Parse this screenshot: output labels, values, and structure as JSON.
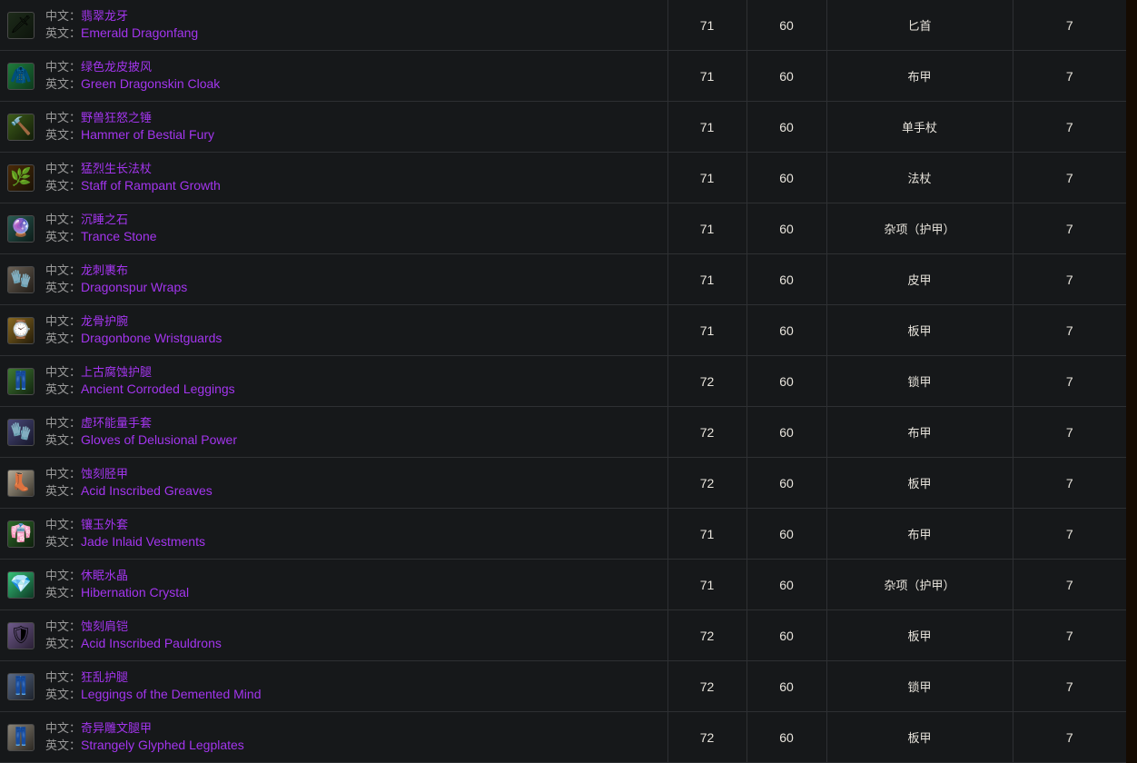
{
  "table": {
    "labels": {
      "cn_label": "中文：",
      "en_label": "英文："
    },
    "colors": {
      "item_name": "#a335ee",
      "label_text": "#9a9a9a",
      "cell_text": "#e8e4dc",
      "row_background": "#16181a",
      "gridline": "#2e3033",
      "page_background": "#150b02"
    },
    "rows": [
      {
        "icon": "dagger-green-icon",
        "icon_glyph": "🗡",
        "icon_bg": "linear-gradient(135deg,#1d2b1a 0%,#0d140c 100%)",
        "name_cn": "翡翠龙牙",
        "name_en": "Emerald Dragonfang",
        "item_level": "71",
        "required_level": "60",
        "type": "匕首",
        "source": "7"
      },
      {
        "icon": "cloak-green-icon",
        "icon_glyph": "🧥",
        "icon_bg": "linear-gradient(135deg,#1f7a3c 0%,#0c3a1c 100%)",
        "name_cn": "绿色龙皮披风",
        "name_en": "Green Dragonskin Cloak",
        "item_level": "71",
        "required_level": "60",
        "type": "布甲",
        "source": "7"
      },
      {
        "icon": "mace-green-icon",
        "icon_glyph": "🔨",
        "icon_bg": "linear-gradient(135deg,#3d5c1a 0%,#121c08 100%)",
        "name_cn": "野兽狂怒之锤",
        "name_en": "Hammer of Bestial Fury",
        "item_level": "71",
        "required_level": "60",
        "type": "单手杖",
        "source": "7"
      },
      {
        "icon": "staff-green-icon",
        "icon_glyph": "🌿",
        "icon_bg": "linear-gradient(135deg,#4a2a08 0%,#1a1205 100%)",
        "name_cn": "猛烈生长法杖",
        "name_en": "Staff of Rampant Growth",
        "item_level": "71",
        "required_level": "60",
        "type": "法杖",
        "source": "7"
      },
      {
        "icon": "orb-stone-icon",
        "icon_glyph": "🔮",
        "icon_bg": "linear-gradient(135deg,#2a5b52 0%,#0c1c19 100%)",
        "name_cn": "沉睡之石",
        "name_en": "Trance Stone",
        "item_level": "71",
        "required_level": "60",
        "type": "杂项（护甲）",
        "source": "7"
      },
      {
        "icon": "bracers-leather-icon",
        "icon_glyph": "🧤",
        "icon_bg": "linear-gradient(135deg,#6b6156 0%,#221d17 100%)",
        "name_cn": "龙刺裹布",
        "name_en": "Dragonspur Wraps",
        "item_level": "71",
        "required_level": "60",
        "type": "皮甲",
        "source": "7"
      },
      {
        "icon": "bracers-plate-icon",
        "icon_glyph": "⌚",
        "icon_bg": "linear-gradient(135deg,#8a6a22 0%,#251c08 100%)",
        "name_cn": "龙骨护腕",
        "name_en": "Dragonbone Wristguards",
        "item_level": "71",
        "required_level": "60",
        "type": "板甲",
        "source": "7"
      },
      {
        "icon": "leggings-mail-icon",
        "icon_glyph": "👖",
        "icon_bg": "linear-gradient(135deg,#3f7a33 0%,#12240f 100%)",
        "name_cn": "上古腐蚀护腿",
        "name_en": "Ancient Corroded Leggings",
        "item_level": "72",
        "required_level": "60",
        "type": "锁甲",
        "source": "7"
      },
      {
        "icon": "gloves-cloth-icon",
        "icon_glyph": "🧤",
        "icon_bg": "linear-gradient(135deg,#4a4a7a 0%,#16162a 100%)",
        "name_cn": "虚环能量手套",
        "name_en": "Gloves of Delusional Power",
        "item_level": "72",
        "required_level": "60",
        "type": "布甲",
        "source": "7"
      },
      {
        "icon": "boots-plate-icon",
        "icon_glyph": "👢",
        "icon_bg": "linear-gradient(135deg,#b5ab97 0%,#3a352c 100%)",
        "name_cn": "蚀刻胫甲",
        "name_en": "Acid Inscribed Greaves",
        "item_level": "72",
        "required_level": "60",
        "type": "板甲",
        "source": "7"
      },
      {
        "icon": "robe-cloth-icon",
        "icon_glyph": "👘",
        "icon_bg": "linear-gradient(135deg,#2e6b2a 0%,#0e1f0c 100%)",
        "name_cn": "镶玉外套",
        "name_en": "Jade Inlaid Vestments",
        "item_level": "71",
        "required_level": "60",
        "type": "布甲",
        "source": "7"
      },
      {
        "icon": "crystal-green-icon",
        "icon_glyph": "💎",
        "icon_bg": "linear-gradient(135deg,#35c27a 0%,#0d3a24 100%)",
        "name_cn": "休眠水晶",
        "name_en": "Hibernation Crystal",
        "item_level": "71",
        "required_level": "60",
        "type": "杂项（护甲）",
        "source": "7"
      },
      {
        "icon": "pauldrons-plate-icon",
        "icon_glyph": "🛡",
        "icon_bg": "linear-gradient(135deg,#6e5a8a 0%,#2a2035 100%)",
        "name_cn": "蚀刻肩铠",
        "name_en": "Acid Inscribed Pauldrons",
        "item_level": "72",
        "required_level": "60",
        "type": "板甲",
        "source": "7"
      },
      {
        "icon": "leggings-mail-blue-icon",
        "icon_glyph": "👖",
        "icon_bg": "linear-gradient(135deg,#5a6a86 0%,#1c222c 100%)",
        "name_cn": "狂乱护腿",
        "name_en": "Leggings of the Demented Mind",
        "item_level": "72",
        "required_level": "60",
        "type": "锁甲",
        "source": "7"
      },
      {
        "icon": "legplates-plate-icon",
        "icon_glyph": "👖",
        "icon_bg": "linear-gradient(135deg,#8a8478 0%,#2c2822 100%)",
        "name_cn": "奇异雕文腿甲",
        "name_en": "Strangely Glyphed Legplates",
        "item_level": "72",
        "required_level": "60",
        "type": "板甲",
        "source": "7"
      }
    ]
  }
}
